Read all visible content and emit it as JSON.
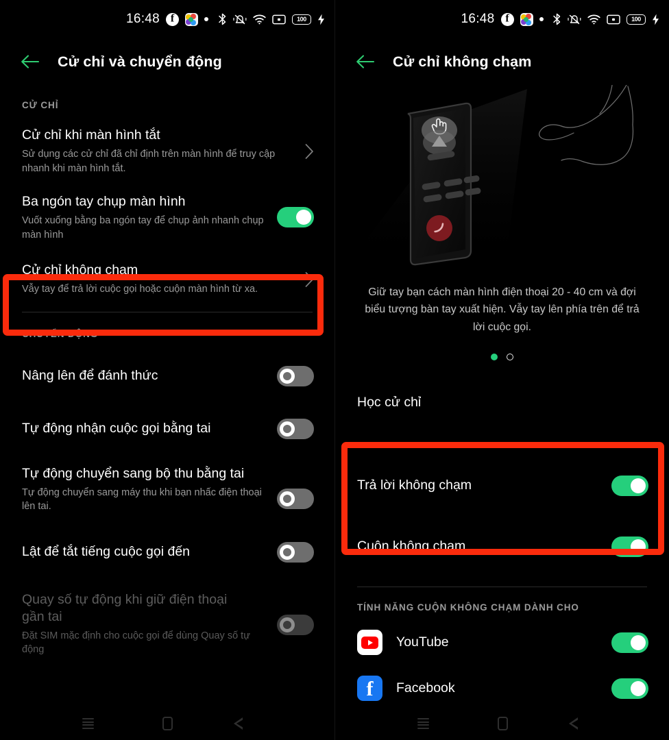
{
  "statusbar": {
    "time": "16:48",
    "notification_icons": [
      "facebook-icon",
      "color-app-icon",
      "dot-icon"
    ],
    "system_icons": [
      "bluetooth-icon",
      "vibrate-mute-icon",
      "wifi-icon",
      "screen-record-icon",
      "battery-icon",
      "charging-bolt-icon"
    ],
    "battery_level": "100"
  },
  "colors": {
    "accent_green": "#25cf7c",
    "highlight_red": "#fb2b0c",
    "background": "#000000",
    "secondary_text": "#9a9a9a"
  },
  "left_panel": {
    "title": "Cử chỉ và chuyển động",
    "back_icon": "back-arrow-icon",
    "sections": [
      {
        "label": "CỬ CHỈ",
        "items": [
          {
            "title": "Cử chỉ khi màn hình tắt",
            "subtitle": "Sử dụng các cử chỉ đã chỉ định trên màn hình để truy cập nhanh khi màn hình tắt.",
            "control": "chevron",
            "highlighted": false,
            "dimmed": false
          },
          {
            "title": "Ba ngón tay chụp màn hình",
            "subtitle": "Vuốt xuống bằng ba ngón tay để chụp ảnh nhanh chụp màn hình",
            "control": "toggle",
            "state": "on",
            "highlighted": false,
            "dimmed": false
          },
          {
            "title": "Cử chỉ không chạm",
            "subtitle": "Vẫy tay để trả lời cuộc gọi hoặc cuộn màn hình từ xa.",
            "control": "chevron",
            "highlighted": true,
            "dimmed": false
          }
        ]
      },
      {
        "label": "CHUYỂN ĐỘNG",
        "items": [
          {
            "title": "Nâng lên để đánh thức",
            "subtitle": "",
            "control": "toggle",
            "state": "off",
            "highlighted": false,
            "dimmed": false
          },
          {
            "title": "Tự động nhận cuộc gọi bằng tai",
            "subtitle": "",
            "control": "toggle",
            "state": "off",
            "highlighted": false,
            "dimmed": false
          },
          {
            "title": "Tự động chuyển sang bộ thu bằng tai",
            "subtitle": "Tự động chuyển sang máy thu khi bạn nhấc điện thoại lên tai.",
            "control": "toggle",
            "state": "off",
            "highlighted": false,
            "dimmed": false
          },
          {
            "title": "Lật để tắt tiếng cuộc gọi đến",
            "subtitle": "",
            "control": "toggle",
            "state": "off",
            "highlighted": false,
            "dimmed": false
          },
          {
            "title": "Quay số tự động khi giữ điện thoại gần tai",
            "subtitle": "Đặt SIM mặc định cho cuộc gọi để dùng Quay số tự động",
            "control": "toggle",
            "state": "off",
            "highlighted": false,
            "dimmed": true
          }
        ]
      }
    ]
  },
  "right_panel": {
    "title": "Cử chỉ không chạm",
    "back_icon": "back-arrow-icon",
    "illustration": {
      "name": "air-gesture-illustration",
      "elements": [
        "phone-device",
        "hand-cursor-icon",
        "up-arrow-icon",
        "end-call-button",
        "line-art-hand"
      ]
    },
    "description": "Giữ tay bạn cách màn hình điện thoại 20 - 40 cm và đợi biểu tượng bàn tay xuất hiện. Vẫy tay lên phía trên để trả lời cuộc gọi.",
    "page_indicator": {
      "total": 2,
      "active": 1
    },
    "learn_item": {
      "title": "Học cử chỉ"
    },
    "highlighted_toggles": [
      {
        "title": "Trả lời không chạm",
        "control": "toggle",
        "state": "on"
      },
      {
        "title": "Cuộn không chạm",
        "control": "toggle",
        "state": "on"
      }
    ],
    "apps_section": {
      "label": "TÍNH NĂNG CUỘN KHÔNG CHẠM DÀNH CHO",
      "apps": [
        {
          "name": "YouTube",
          "icon": "youtube-icon",
          "control": "toggle",
          "state": "on"
        },
        {
          "name": "Facebook",
          "icon": "facebook-icon",
          "control": "toggle",
          "state": "on"
        }
      ]
    }
  },
  "navbar": {
    "buttons": [
      {
        "name": "recents-button",
        "icon": "recents-icon"
      },
      {
        "name": "home-button",
        "icon": "home-icon"
      },
      {
        "name": "back-button",
        "icon": "back-triangle-icon"
      }
    ]
  }
}
